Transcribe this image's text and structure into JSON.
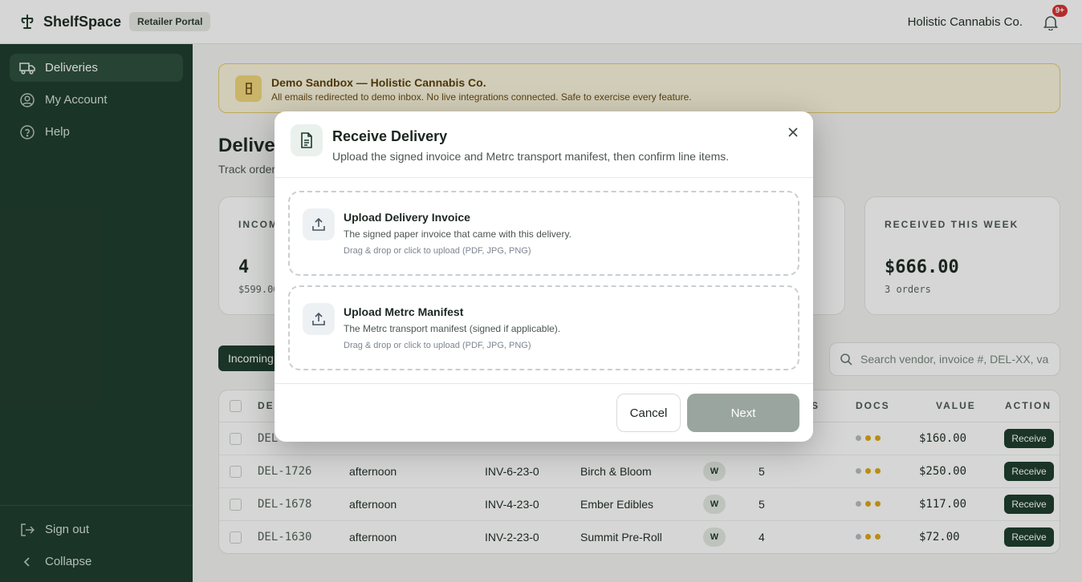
{
  "topbar": {
    "brand_name": "ShelfSpace",
    "portal_badge": "Retailer Portal",
    "org_name": "Holistic Cannabis Co.",
    "notification_count": "9+"
  },
  "sidebar": {
    "items": [
      {
        "label": "Deliveries",
        "icon": "truck-icon"
      },
      {
        "label": "My Account",
        "icon": "user-circle-icon"
      },
      {
        "label": "Help",
        "icon": "help-circle-icon"
      }
    ],
    "sign_out": "Sign out",
    "collapse": "Collapse"
  },
  "banner": {
    "title": "Demo Sandbox — Holistic Cannabis Co.",
    "text": "All emails redirected to demo inbox. No live integrations connected. Safe to exercise every feature."
  },
  "page": {
    "title": "Deliveries",
    "subtitle": "Track orders"
  },
  "stats": [
    {
      "label": "INCOMING",
      "value": "4",
      "sub": "$599.00"
    },
    {
      "label": "RECEIVED THIS WEEK",
      "value": "$666.00",
      "sub": "3 orders"
    }
  ],
  "tabs": {
    "incoming": "Incoming"
  },
  "search": {
    "placeholder": "Search vendor, invoice #, DEL-XX, va"
  },
  "table": {
    "headers": {
      "id": "DE",
      "items": "S",
      "docs": "DOCS",
      "value": "VALUE",
      "action": "ACTION"
    },
    "rows": [
      {
        "id": "DEL",
        "time": "",
        "invoice": "",
        "vendor": "",
        "type": "",
        "items": "",
        "value": "$160.00",
        "action": "Receive"
      },
      {
        "id": "DEL-1726",
        "time": "afternoon",
        "invoice": "INV-6-23-0",
        "vendor": "Birch & Bloom",
        "type": "W",
        "items": "5",
        "value": "$250.00",
        "action": "Receive"
      },
      {
        "id": "DEL-1678",
        "time": "afternoon",
        "invoice": "INV-4-23-0",
        "vendor": "Ember Edibles",
        "type": "W",
        "items": "5",
        "value": "$117.00",
        "action": "Receive"
      },
      {
        "id": "DEL-1630",
        "time": "afternoon",
        "invoice": "INV-2-23-0",
        "vendor": "Summit Pre-Roll",
        "type": "W",
        "items": "4",
        "value": "$72.00",
        "action": "Receive"
      }
    ],
    "doc_colors": [
      "#b8bcc2",
      "#e0a50f",
      "#e0a50f"
    ]
  },
  "modal": {
    "title": "Receive Delivery",
    "subtitle": "Upload the signed invoice and Metrc transport manifest, then confirm line items.",
    "uploads": [
      {
        "title": "Upload Delivery Invoice",
        "desc": "The signed paper invoice that came with this delivery.",
        "hint": "Drag & drop or click to upload (PDF, JPG, PNG)"
      },
      {
        "title": "Upload Metrc Manifest",
        "desc": "The Metrc transport manifest (signed if applicable).",
        "hint": "Drag & drop or click to upload (PDF, JPG, PNG)"
      }
    ],
    "cancel": "Cancel",
    "next": "Next"
  }
}
